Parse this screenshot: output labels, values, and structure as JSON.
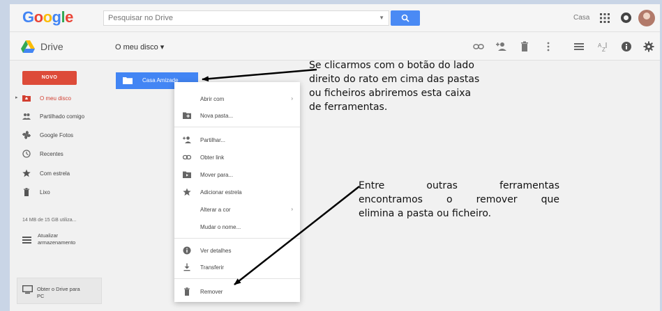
{
  "topbar": {
    "logo_letters": [
      {
        "char": "G",
        "color": "#4285f4"
      },
      {
        "char": "o",
        "color": "#ea4335"
      },
      {
        "char": "o",
        "color": "#fbbc05"
      },
      {
        "char": "g",
        "color": "#4285f4"
      },
      {
        "char": "l",
        "color": "#34a853"
      },
      {
        "char": "e",
        "color": "#ea4335"
      }
    ],
    "search_placeholder": "Pesquisar no Drive",
    "account_label": "Casa"
  },
  "toolbar": {
    "app_name": "Drive",
    "location_title": "O meu disco ▾",
    "icons": [
      "link-icon",
      "add-person-icon",
      "trash-icon",
      "more-vert-icon",
      "list-view-icon",
      "sort-az-icon",
      "info-icon",
      "settings-icon"
    ]
  },
  "sidebar": {
    "new_label": "NOVO",
    "items": [
      {
        "label": "O meu disco",
        "icon": "drive-folder-icon",
        "active": true
      },
      {
        "label": "Partilhado comigo",
        "icon": "people-icon"
      },
      {
        "label": "Google Fotos",
        "icon": "photos-pinwheel-icon"
      },
      {
        "label": "Recentes",
        "icon": "clock-icon"
      },
      {
        "label": "Com estrela",
        "icon": "star-icon"
      },
      {
        "label": "Lixo",
        "icon": "trash-icon"
      }
    ],
    "storage_text": "14 MB de 15 GB utiliza...",
    "upgrade_label": [
      "Atualizar",
      "armazenamento"
    ],
    "get_drive_label": [
      "Obter o Drive para",
      "PC"
    ]
  },
  "folder": {
    "name": "Casa Amizade"
  },
  "context_menu": {
    "items": [
      {
        "label": "Abrir com",
        "icon": "",
        "submenu": true
      },
      {
        "label": "Nova pasta...",
        "icon": "new-folder-icon"
      },
      {
        "label": "Partilhar...",
        "icon": "add-person-icon"
      },
      {
        "label": "Obter link",
        "icon": "link-icon"
      },
      {
        "label": "Mover para...",
        "icon": "move-folder-icon"
      },
      {
        "label": "Adicionar estrela",
        "icon": "star-icon"
      },
      {
        "label": "Alterar a cor",
        "icon": "",
        "submenu": true
      },
      {
        "label": "Mudar o nome...",
        "icon": ""
      },
      {
        "label": "Ver detalhes",
        "icon": "info-icon"
      },
      {
        "label": "Transferir",
        "icon": "download-icon"
      },
      {
        "label": "Remover",
        "icon": "trash-icon"
      }
    ]
  },
  "annotations": {
    "first": [
      "Se clicarmos com o botão do lado",
      "direito do rato em cima das pastas",
      "ou ficheiros abriremos esta caixa",
      "de ferramentas."
    ],
    "second": [
      "Entre outras ferramentas",
      "encontramos o remover que",
      "elimina a pasta ou ficheiro."
    ]
  },
  "colors": {
    "accent_red": "#dd4b39",
    "accent_blue": "#4285f4",
    "search_blue": "#4a8af4"
  }
}
